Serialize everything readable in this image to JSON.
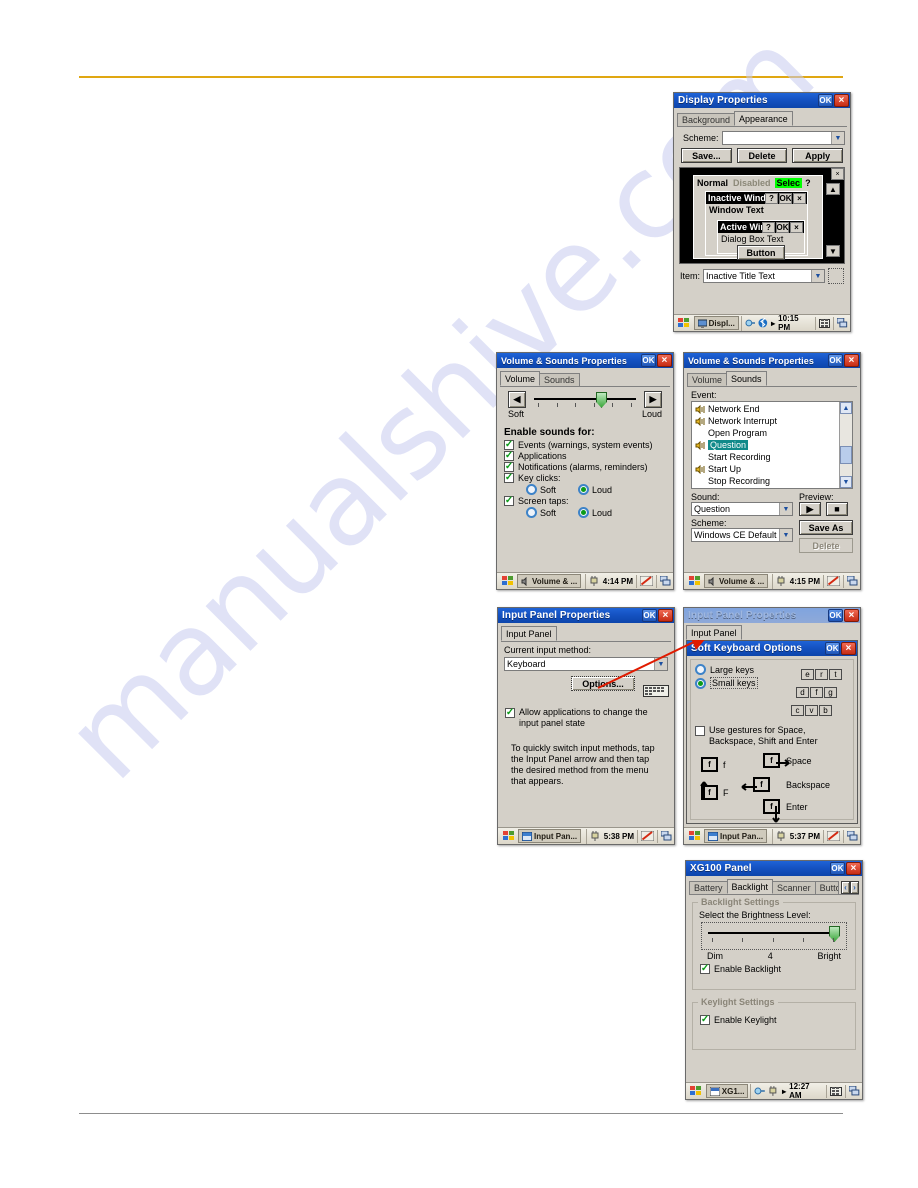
{
  "page": {
    "watermark": "manualshive.com",
    "rule_top_color": "#e0a712",
    "rule_bottom_color": "#8d8d8d"
  },
  "display_properties": {
    "title": "Display Properties",
    "ok_label": "OK",
    "close_label": "×",
    "tabs": [
      {
        "label": "Background",
        "selected": false
      },
      {
        "label": "Appearance",
        "selected": true
      }
    ],
    "scheme_label": "Scheme:",
    "scheme_value": "",
    "buttons": {
      "save": "Save...",
      "delete": "Delete",
      "apply": "Apply"
    },
    "preview": {
      "normal": "Normal",
      "disabled": "Disabled",
      "selected": "Selec",
      "help": "?",
      "close": "×",
      "inactive_title": "Inactive Wind",
      "window_text": "Window Text",
      "active_title": "Active Win",
      "dialog_box_text": "Dialog Box Text",
      "button": "Button",
      "ok": "OK",
      "up": "▲",
      "down": "▼"
    },
    "item_label": "Item:",
    "item_value": "Inactive Title Text",
    "taskbar": {
      "task": "Displ...",
      "time": "10:15 PM"
    }
  },
  "volume_sounds_volume": {
    "title": "Volume & Sounds Properties",
    "ok_label": "OK",
    "close_label": "×",
    "tabs": [
      {
        "label": "Volume",
        "selected": true
      },
      {
        "label": "Sounds",
        "selected": false
      }
    ],
    "soft_label": "Soft",
    "loud_label": "Loud",
    "left_arrow": "◀",
    "right_arrow": "▶",
    "group_label": "Enable sounds for:",
    "checkboxes": [
      {
        "label": "Events (warnings, system events)",
        "checked": true
      },
      {
        "label": "Applications",
        "checked": true
      },
      {
        "label": "Notifications (alarms, reminders)",
        "checked": true
      },
      {
        "label": "Key clicks:",
        "checked": true
      },
      {
        "label": "Screen taps:",
        "checked": true
      }
    ],
    "key_clicks_soft": "Soft",
    "key_clicks_loud": "Loud",
    "screen_taps_soft": "Soft",
    "screen_taps_loud": "Loud",
    "taskbar": {
      "task": "Volume & ...",
      "time": "4:14 PM"
    }
  },
  "volume_sounds_sounds": {
    "title": "Volume & Sounds Properties",
    "ok_label": "OK",
    "close_label": "×",
    "tabs": [
      {
        "label": "Volume",
        "selected": false
      },
      {
        "label": "Sounds",
        "selected": true
      }
    ],
    "event_label": "Event:",
    "events": [
      {
        "name": "Network End",
        "has_sound": true,
        "selected": false
      },
      {
        "name": "Network Interrupt",
        "has_sound": true,
        "selected": false
      },
      {
        "name": "Open Program",
        "has_sound": false,
        "selected": false
      },
      {
        "name": "Question",
        "has_sound": true,
        "selected": true
      },
      {
        "name": "Start Recording",
        "has_sound": false,
        "selected": false
      },
      {
        "name": "Start Up",
        "has_sound": true,
        "selected": false
      },
      {
        "name": "Stop Recording",
        "has_sound": false,
        "selected": false
      }
    ],
    "sound_label": "Sound:",
    "sound_value": "Question",
    "preview_label": "Preview:",
    "play_glyph": "▶",
    "stop_glyph": "■",
    "scheme_label": "Scheme:",
    "scheme_value": "Windows CE Default",
    "save_as_label": "Save As",
    "delete_label": "Delete",
    "taskbar": {
      "task": "Volume & ...",
      "time": "4:15 PM"
    }
  },
  "input_panel": {
    "title": "Input Panel Properties",
    "ok_label": "OK",
    "close_label": "×",
    "tabs": [
      {
        "label": "Input Panel",
        "selected": true
      }
    ],
    "method_label": "Current input method:",
    "method_value": "Keyboard",
    "options_label": "Options...",
    "allow_checkbox": {
      "label": "Allow applications to change the input panel state",
      "checked": true
    },
    "hint": "To quickly switch input methods, tap the Input Panel arrow and then tap the desired method from the menu that appears.",
    "taskbar": {
      "task": "Input Pan...",
      "time": "5:38 PM"
    }
  },
  "soft_keyboard": {
    "parent_title": "Input Panel Properties",
    "parent_tab": "Input Panel",
    "title": "Soft Keyboard Options",
    "ok_label": "OK",
    "close_label": "×",
    "radios": [
      {
        "label": "Large keys",
        "selected": false
      },
      {
        "label": "Small keys",
        "selected": true
      }
    ],
    "key_preview_rows": [
      [
        "e",
        "r",
        "t"
      ],
      [
        "d",
        "f",
        "g"
      ],
      [
        "c",
        "v",
        "b"
      ]
    ],
    "gestures_checkbox": {
      "label": "Use gestures for Space, Backspace, Shift and Enter",
      "checked": false
    },
    "gesture_items": [
      {
        "glyph": "f",
        "label": "f"
      },
      {
        "glyph": "f",
        "label": "F"
      },
      {
        "glyph": "f",
        "label": "Space"
      },
      {
        "glyph": "f",
        "label": "Backspace"
      },
      {
        "glyph": "f",
        "label": "Enter"
      }
    ],
    "taskbar": {
      "task": "Input Pan...",
      "time": "5:37 PM"
    }
  },
  "xg100_panel": {
    "title": "XG100 Panel",
    "ok_label": "OK",
    "close_label": "×",
    "tabs": [
      {
        "label": "Battery",
        "selected": false
      },
      {
        "label": "Backlight",
        "selected": true
      },
      {
        "label": "Scanner",
        "selected": false
      },
      {
        "label": "Butto",
        "selected": false
      }
    ],
    "tab_prev": "‹",
    "tab_next": "›",
    "backlight_group": "Backlight Settings",
    "brightness_label": "Select the Brightness Level:",
    "dim_label": "Dim",
    "level_label": "4",
    "bright_label": "Bright",
    "enable_backlight": {
      "label": "Enable Backlight",
      "checked": true
    },
    "keylight_group": "Keylight Settings",
    "enable_keylight": {
      "label": "Enable Keylight",
      "checked": true
    },
    "taskbar": {
      "task": "XG1...",
      "time": "12:27 AM"
    }
  }
}
